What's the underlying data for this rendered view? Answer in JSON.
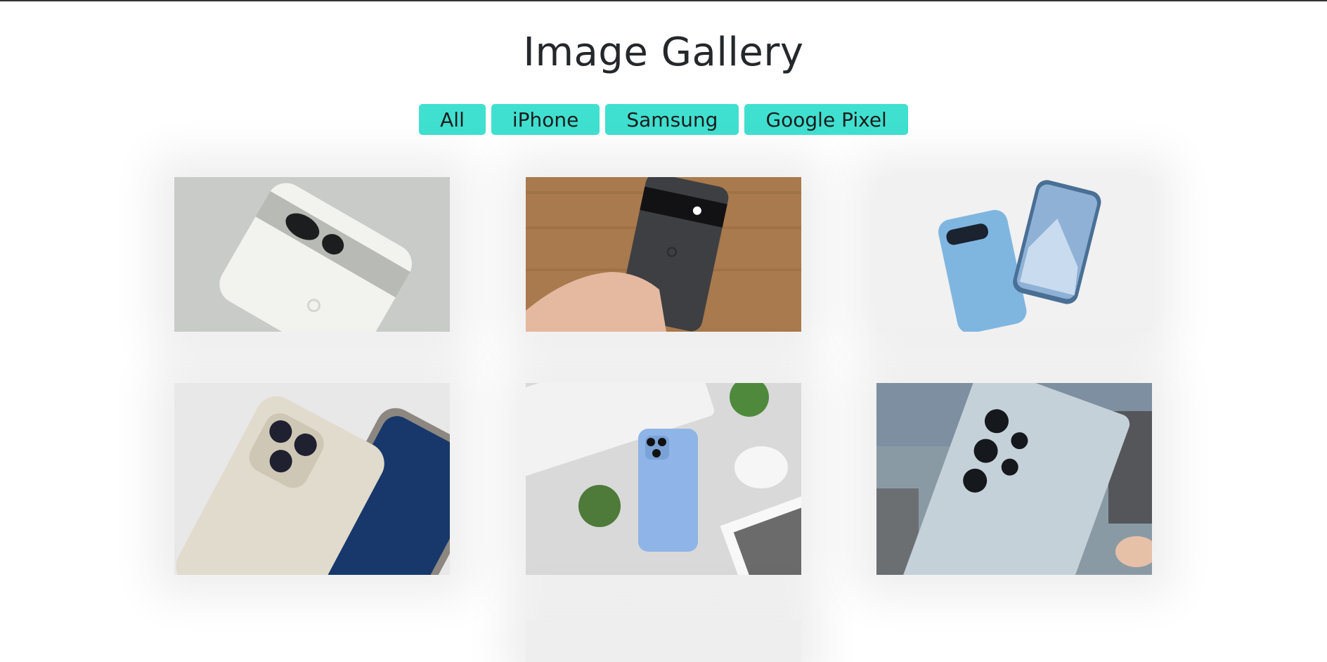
{
  "page": {
    "title": "Image Gallery"
  },
  "filters": [
    {
      "label": "All"
    },
    {
      "label": "iPhone"
    },
    {
      "label": "Samsung"
    },
    {
      "label": "Google Pixel"
    }
  ],
  "gallery": {
    "items": [
      {
        "icon": "white-google-pixel-phone-image"
      },
      {
        "icon": "hand-holding-black-google-pixel-image"
      },
      {
        "icon": "blue-google-pixel-phones-image"
      },
      {
        "icon": "natural-titanium-iphone-image"
      },
      {
        "icon": "sierra-blue-iphone-on-desk-image"
      },
      {
        "icon": "samsung-galaxy-ultra-in-hand-image"
      }
    ]
  },
  "colors": {
    "accent": "#40e0d0",
    "title": "#25282b"
  }
}
